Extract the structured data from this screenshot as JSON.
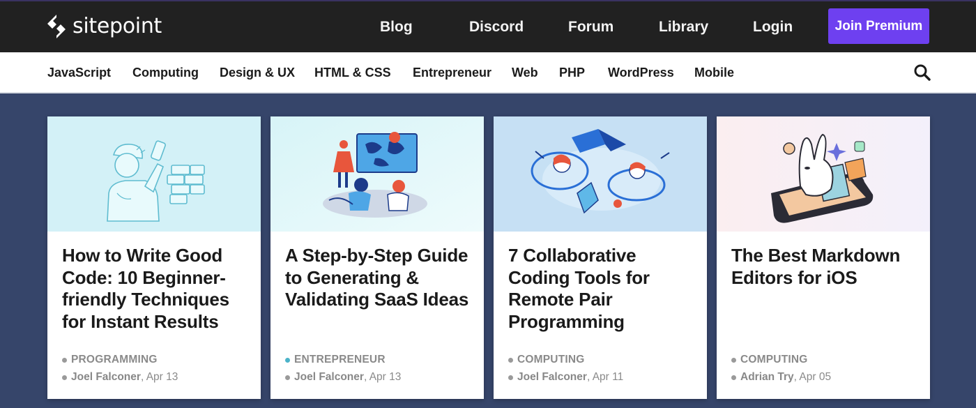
{
  "header": {
    "logo_text": "sitepoint",
    "nav": [
      "Blog",
      "Discord",
      "Forum",
      "Library",
      "Login"
    ],
    "premium_label": "Join Premium"
  },
  "categories": [
    "JavaScript",
    "Computing",
    "Design & UX",
    "HTML & CSS",
    "Entrepreneur",
    "Web",
    "PHP",
    "WordPress",
    "Mobile"
  ],
  "colors": {
    "premium_button": "#6e40f0",
    "page_background": "#36456a",
    "entrepreneur_dot": "#4bb3c9",
    "default_dot": "#9a9a9a"
  },
  "articles": [
    {
      "title": "How to Write Good Code: 10 Beginner-friendly Techniques for Instant Results",
      "category": "PROGRAMMING",
      "author": "Joel Falconer",
      "date": ", Apr 13"
    },
    {
      "title": "A Step-by-Step Guide to Generating & Validating SaaS Ideas",
      "category": "ENTREPRENEUR",
      "author": "Joel Falconer",
      "date": ", Apr 13"
    },
    {
      "title": "7 Collaborative Coding Tools for Remote Pair Programming",
      "category": "COMPUTING",
      "author": "Joel Falconer",
      "date": ", Apr 11"
    },
    {
      "title": "The Best Markdown Editors for iOS",
      "category": "COMPUTING",
      "author": "Adrian Try",
      "date": ", Apr 05"
    }
  ]
}
